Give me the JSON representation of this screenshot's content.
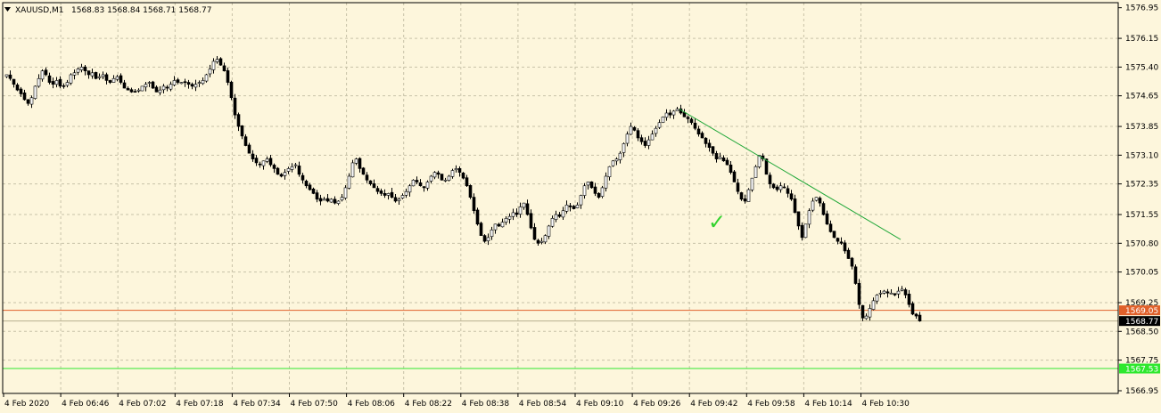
{
  "header": {
    "symbol": "XAUUSD,M1",
    "ohlc": "1568.83 1568.84 1568.71 1568.77"
  },
  "colors": {
    "background": "#fdf6dc",
    "grid": "#c8c2a8",
    "candle": "#000000",
    "trendline": "#22a83a",
    "checkmark": "#34d22f",
    "level_orange": "#e0602a",
    "level_price": "#000000",
    "level_green": "#2ee82e"
  },
  "chart_data": {
    "type": "candlestick",
    "ylim": [
      1566.95,
      1577.0
    ],
    "y_ticks": [
      "1576.95",
      "1576.15",
      "1575.40",
      "1574.65",
      "1573.85",
      "1573.10",
      "1572.35",
      "1571.55",
      "1570.80",
      "1570.05",
      "1569.25",
      "1568.50",
      "1567.75",
      "1566.95"
    ],
    "x_ticks": [
      "4 Feb 2020",
      "4 Feb 06:46",
      "4 Feb 07:02",
      "4 Feb 07:18",
      "4 Feb 07:34",
      "4 Feb 07:50",
      "4 Feb 08:06",
      "4 Feb 08:22",
      "4 Feb 08:38",
      "4 Feb 08:54",
      "4 Feb 09:10",
      "4 Feb 09:26",
      "4 Feb 09:42",
      "4 Feb 09:58",
      "4 Feb 10:14",
      "4 Feb 10:30"
    ],
    "horizontal_levels": [
      {
        "price": 1569.05,
        "label": "1569.05",
        "color": "#e0602a"
      },
      {
        "price": 1568.77,
        "label": "1568.77",
        "color": "#000000"
      },
      {
        "price": 1567.53,
        "label": "1567.53",
        "color": "#2ee82e"
      }
    ],
    "trendline": {
      "from": {
        "bar": 189,
        "price": 1574.3
      },
      "to": {
        "bar": 251,
        "price": 1570.9
      }
    },
    "annotation": {
      "symbol": "✓",
      "bar": 197,
      "price": 1571.35
    },
    "closes": [
      1575.2,
      1575.1,
      1574.95,
      1574.8,
      1574.7,
      1574.55,
      1574.45,
      1574.6,
      1574.9,
      1575.1,
      1575.3,
      1575.2,
      1575.0,
      1574.95,
      1575.05,
      1574.9,
      1574.9,
      1575.0,
      1575.2,
      1575.25,
      1575.35,
      1575.4,
      1575.3,
      1575.2,
      1575.25,
      1575.1,
      1575.15,
      1575.2,
      1575.05,
      1575.0,
      1575.1,
      1575.15,
      1575.0,
      1574.85,
      1574.8,
      1574.75,
      1574.75,
      1574.8,
      1574.9,
      1574.95,
      1575.0,
      1574.85,
      1574.75,
      1574.8,
      1574.9,
      1574.85,
      1574.95,
      1575.05,
      1575.0,
      1575.0,
      1575.0,
      1574.95,
      1574.9,
      1574.95,
      1575.0,
      1575.05,
      1575.2,
      1575.35,
      1575.55,
      1575.6,
      1575.45,
      1575.3,
      1575.0,
      1574.6,
      1574.15,
      1573.85,
      1573.6,
      1573.35,
      1573.15,
      1573.0,
      1572.9,
      1572.85,
      1572.95,
      1573.0,
      1572.85,
      1572.75,
      1572.6,
      1572.55,
      1572.65,
      1572.75,
      1572.8,
      1572.85,
      1572.6,
      1572.45,
      1572.3,
      1572.2,
      1572.1,
      1571.95,
      1571.9,
      1571.95,
      1571.9,
      1571.95,
      1571.85,
      1571.9,
      1572.0,
      1572.25,
      1572.55,
      1572.9,
      1573.0,
      1572.75,
      1572.6,
      1572.45,
      1572.35,
      1572.25,
      1572.15,
      1572.1,
      1572.05,
      1572.1,
      1572.0,
      1571.9,
      1571.95,
      1572.05,
      1572.15,
      1572.3,
      1572.45,
      1572.4,
      1572.3,
      1572.25,
      1572.4,
      1572.55,
      1572.65,
      1572.6,
      1572.45,
      1572.45,
      1572.55,
      1572.7,
      1572.75,
      1572.65,
      1572.5,
      1572.3,
      1572.0,
      1571.65,
      1571.3,
      1571.0,
      1570.85,
      1570.95,
      1571.15,
      1571.3,
      1571.25,
      1571.35,
      1571.45,
      1571.5,
      1571.6,
      1571.55,
      1571.75,
      1571.85,
      1571.55,
      1571.2,
      1570.9,
      1570.8,
      1570.85,
      1571.0,
      1571.25,
      1571.45,
      1571.55,
      1571.5,
      1571.65,
      1571.8,
      1571.75,
      1571.7,
      1571.8,
      1572.05,
      1572.3,
      1572.4,
      1572.25,
      1572.1,
      1572.0,
      1572.25,
      1572.55,
      1572.8,
      1572.95,
      1573.0,
      1573.15,
      1573.4,
      1573.65,
      1573.85,
      1573.75,
      1573.55,
      1573.45,
      1573.35,
      1573.5,
      1573.65,
      1573.8,
      1573.95,
      1574.1,
      1574.2,
      1574.15,
      1574.25,
      1574.3,
      1574.2,
      1574.1,
      1574.05,
      1573.95,
      1573.8,
      1573.65,
      1573.55,
      1573.4,
      1573.3,
      1573.15,
      1573.0,
      1573.05,
      1572.95,
      1572.85,
      1572.65,
      1572.4,
      1572.15,
      1571.95,
      1571.9,
      1572.2,
      1572.5,
      1572.8,
      1573.1,
      1573.0,
      1572.6,
      1572.35,
      1572.25,
      1572.2,
      1572.3,
      1572.25,
      1572.1,
      1571.95,
      1571.6,
      1571.25,
      1570.95,
      1571.3,
      1571.65,
      1571.9,
      1572.0,
      1571.85,
      1571.55,
      1571.3,
      1571.1,
      1570.95,
      1570.85,
      1570.8,
      1570.6,
      1570.4,
      1570.2,
      1569.75,
      1569.2,
      1568.85,
      1568.9,
      1569.1,
      1569.3,
      1569.45,
      1569.5,
      1569.55,
      1569.5,
      1569.5,
      1569.45,
      1569.55,
      1569.6,
      1569.45,
      1569.2,
      1568.95,
      1568.9,
      1568.77
    ]
  }
}
